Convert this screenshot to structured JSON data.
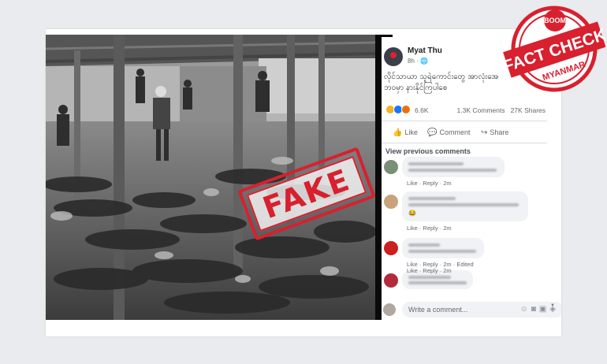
{
  "post": {
    "author": "Myat Thu",
    "time": "8h · 🌐",
    "text_line1": "လိုင်သာယာ သူရဲကောင်းတွေ အာလုံးအေ",
    "text_line2": "ဘဝမှာ နားနိုင်ကြပါစေ"
  },
  "stats": {
    "reaction_count": "6.6K",
    "comments": "1.3K Comments",
    "shares": "27K Shares"
  },
  "actions": {
    "like": "Like",
    "comment": "Comment",
    "share": "Share"
  },
  "view_previous": "View previous comments",
  "comments": [
    {
      "meta": "Like · Reply · 2m"
    },
    {
      "meta": "Like · Reply · 2m"
    },
    {
      "meta": "Like · Reply · 2m · Edited"
    },
    {
      "meta": "Like · Reply · 2m"
    }
  ],
  "write_placeholder": "Write a comment...",
  "stamp": {
    "text": "FAKE"
  },
  "badge": {
    "top": "BOOM",
    "main1": "FACT",
    "main2": "CHECK",
    "bottom": "MYANMAR"
  },
  "colors": {
    "stamp_red": "#d8202e",
    "fb_blue": "#1877f2"
  }
}
